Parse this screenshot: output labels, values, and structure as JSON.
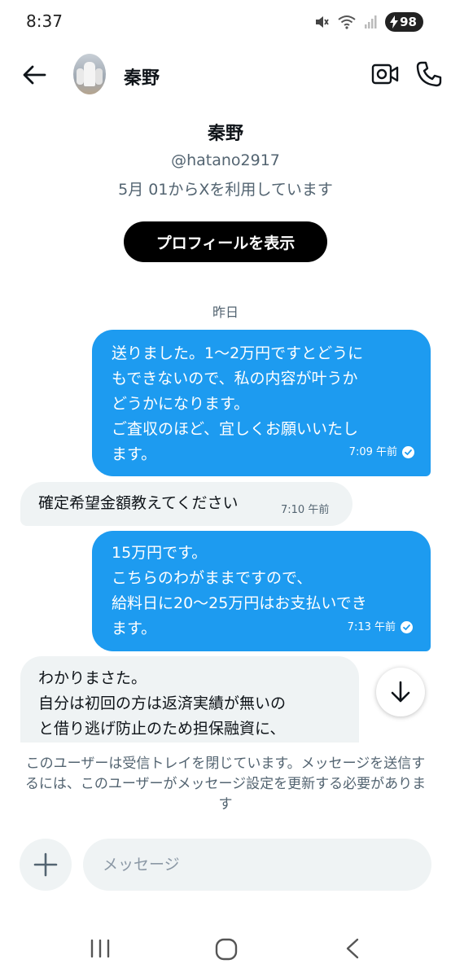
{
  "status_bar": {
    "time": "8:37",
    "battery": "98",
    "icons": [
      "mute-icon",
      "wifi-icon",
      "signal-icon",
      "battery-charging-icon"
    ]
  },
  "header": {
    "name": "秦野",
    "icons": [
      "back-arrow-icon",
      "video-call-icon",
      "phone-icon"
    ]
  },
  "profile": {
    "name": "秦野",
    "handle": "@hatano2917",
    "joined": "5月 01からXを利用しています",
    "view_profile_button": "プロフィールを表示"
  },
  "date_separator": "昨日",
  "messages": [
    {
      "direction": "sent",
      "text": "送りました。1〜2万円ですとどうに\nもできないので、私の内容が叶うか\nどうかになります。\nご査収のほど、宜しくお願いいたし\nます。",
      "time": "7:09 午前",
      "status": "read"
    },
    {
      "direction": "received",
      "text": "確定希望金額教えてください",
      "time": "7:10 午前"
    },
    {
      "direction": "sent",
      "text": "15万円です。\nこちらのわがままですので、\n給料日に20〜25万円はお支払いでき\nます。",
      "time": "7:13 午前",
      "status": "read"
    },
    {
      "direction": "received",
      "text": "わかりまさた。\n自分は初回の方は返済実績が無いの\nと借り逃げ防止のため担保融資に、"
    }
  ],
  "notice": "このユーザーは受信トレイを閉じています。メッセージを送信するには、このユーザーがメッセージ設定を更新する必要があります",
  "composer": {
    "placeholder": "メッセージ"
  },
  "colors": {
    "sent_bubble": "#1d9bf0",
    "received_bubble": "#eff3f4",
    "secondary_text": "#536471"
  }
}
